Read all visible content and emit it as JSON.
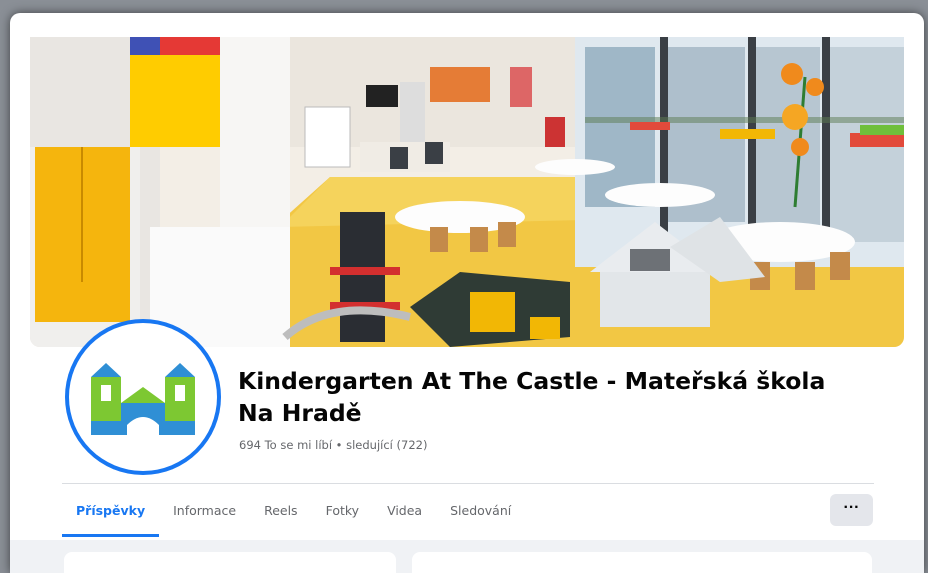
{
  "page": {
    "name": "Kindergarten At The Castle - Mateřská škola Na Hradě",
    "stats": "694 To se mi líbí • sledující (722)"
  },
  "tabs": [
    {
      "label": "Příspěvky",
      "active": true
    },
    {
      "label": "Informace",
      "active": false
    },
    {
      "label": "Reels",
      "active": false
    },
    {
      "label": "Fotky",
      "active": false
    },
    {
      "label": "Videa",
      "active": false
    },
    {
      "label": "Sledování",
      "active": false
    }
  ],
  "more_button": {
    "label": "···",
    "icon": "more-horizontal-icon"
  },
  "colors": {
    "accent": "#1877f2",
    "logo_green": "#7dc832",
    "logo_blue": "#2f8fd5",
    "text_secondary": "#65676b"
  },
  "cover": {
    "icon": "classroom-cover-photo"
  },
  "avatar": {
    "icon": "castle-logo-icon"
  }
}
